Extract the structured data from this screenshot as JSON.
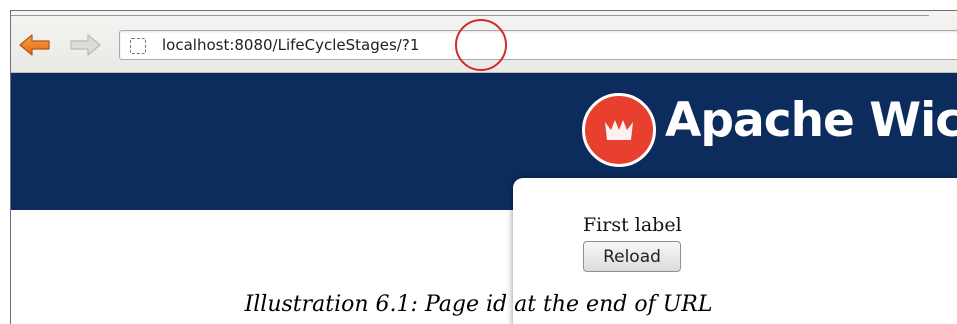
{
  "browser": {
    "back_icon": "back-arrow-icon",
    "forward_icon": "forward-arrow-icon",
    "page_icon": "page-icon",
    "url": "localhost:8080/LifeCycleStages/?1",
    "annotation_color": "#d42a2a"
  },
  "header": {
    "brand": "Apache Wicket",
    "logo_icon": "wicket-logo-icon",
    "background_color": "#0d2c5e",
    "logo_color": "#e8402e"
  },
  "content": {
    "label_text": "First label",
    "reload_label": "Reload"
  },
  "caption": "Illustration 6.1: Page id at the end of URL"
}
